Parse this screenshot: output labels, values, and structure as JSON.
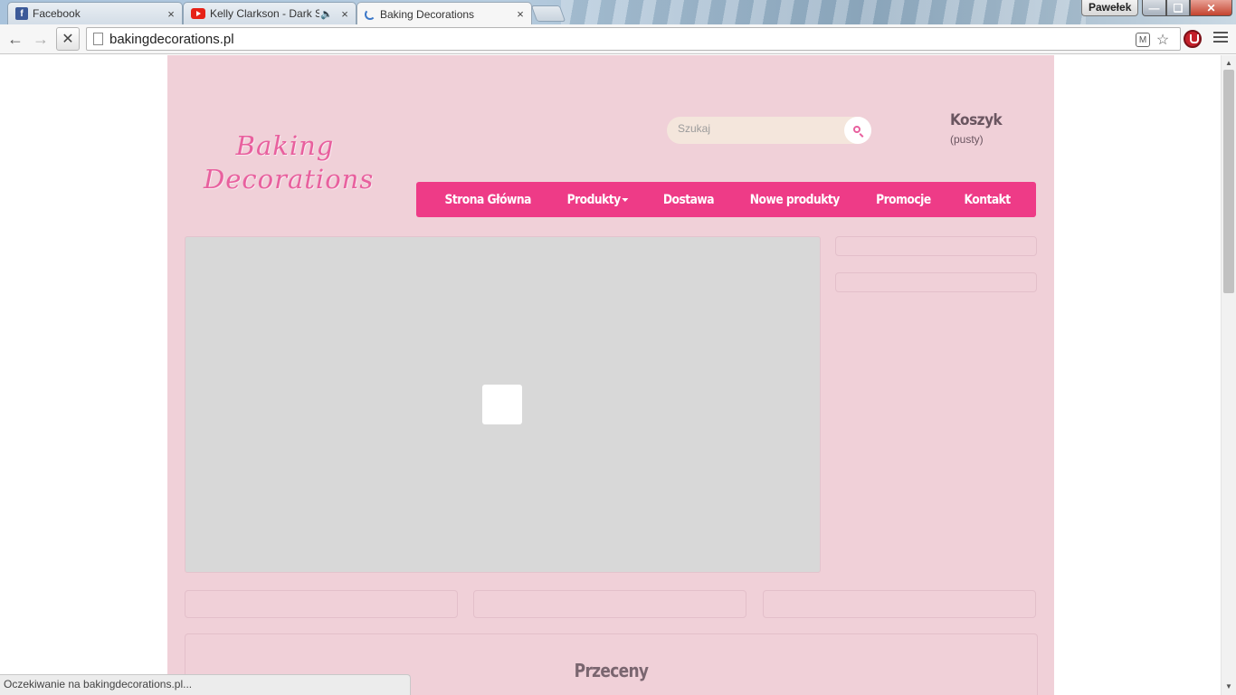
{
  "browser": {
    "tabs": [
      {
        "title": "Facebook",
        "favicon": "facebook-icon",
        "active": false
      },
      {
        "title": "Kelly Clarkson - Dark Si",
        "favicon": "youtube-icon",
        "active": false,
        "audio": true
      },
      {
        "title": "Baking Decorations",
        "favicon": "loading-spinner-icon",
        "active": true
      }
    ],
    "profile_name": "Pawełek",
    "close_glyph": "×",
    "url": "bakingdecorations.pl",
    "status_text": "Oczekiwanie na bakingdecorations.pl..."
  },
  "site": {
    "logo_line1": "Baking",
    "logo_line2": "Decorations",
    "search": {
      "placeholder": "Szukaj"
    },
    "cart": {
      "title": "Koszyk",
      "status": "(pusty)"
    },
    "nav": [
      {
        "label": "Strona Główna"
      },
      {
        "label": "Produkty",
        "has_dropdown": true
      },
      {
        "label": "Dostawa"
      },
      {
        "label": "Nowe produkty"
      },
      {
        "label": "Promocje"
      },
      {
        "label": "Kontakt"
      }
    ],
    "section_title": "Przeceny",
    "colors": {
      "background": "#f0d0d8",
      "nav": "#ee3b87",
      "logo": "#e8609e",
      "slider": "#d8d8d8"
    }
  }
}
